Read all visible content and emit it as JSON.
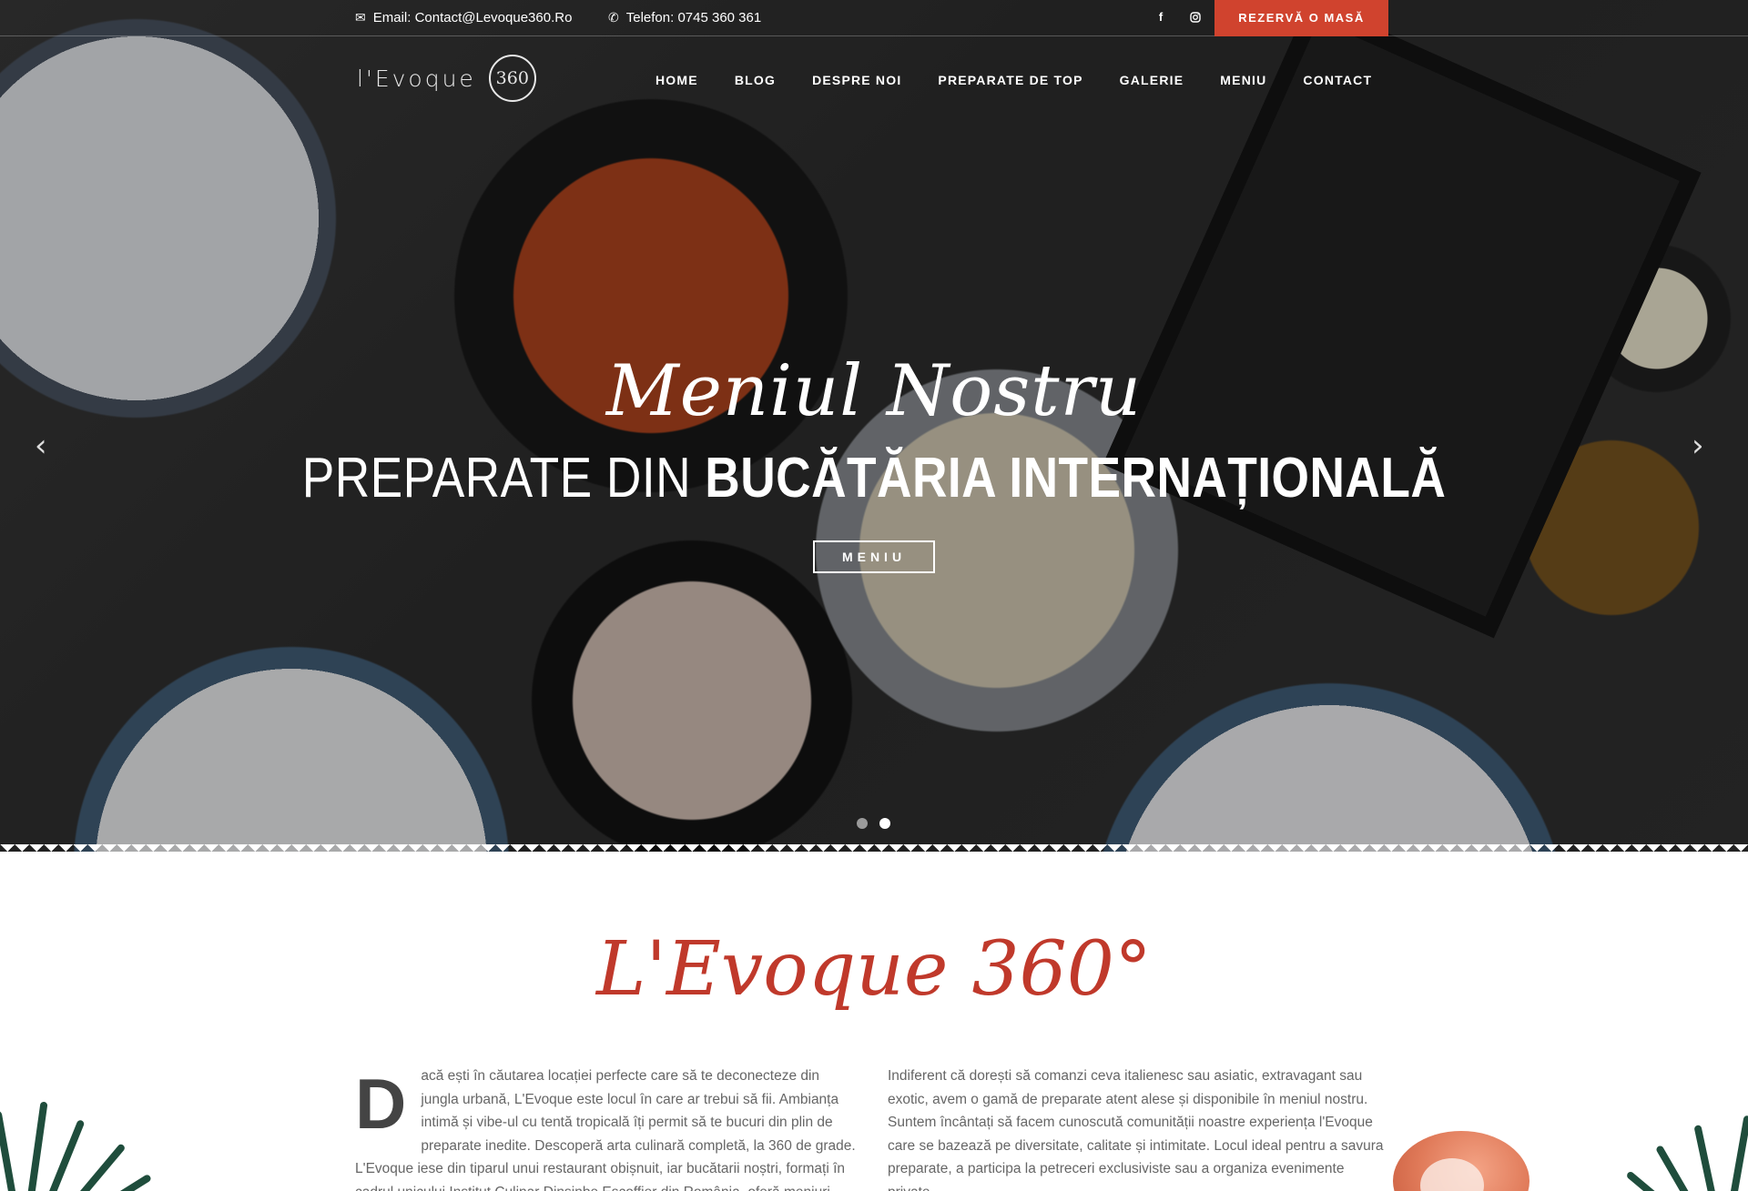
{
  "topbar": {
    "email": "Email: Contact@Levoque360.Ro",
    "phone": "Telefon: 0745 360 361",
    "reserve": "REZERVĂ O MASĂ",
    "social": [
      "facebook-icon",
      "instagram-icon"
    ]
  },
  "logo": {
    "text": "l'Evoque",
    "mark": "360"
  },
  "nav": [
    "HOME",
    "BLOG",
    "DESPRE NOI",
    "PREPARATE DE TOP",
    "GALERIE",
    "MENIU",
    "CONTACT"
  ],
  "hero": {
    "script": "Meniul Nostru",
    "title_light": "PREPARATE DIN ",
    "title_bold": "BUCĂTĂRIA INTERNAȚIONALĂ",
    "button": "MENIU",
    "slides": 2,
    "active_slide": 2
  },
  "intro": {
    "title": "L'Evoque 360°",
    "dropcap": "D",
    "left_text": "acă ești în căutarea locației perfecte care să te deconecteze din jungla urbană, L'Evoque este locul în care ar trebui să fii. Ambianța intimă și vibe-ul cu tentă tropicală îți permit să te bucuri din plin de preparate inedite. Descoperă arta culinară completă, la 360 de grade. L'Evoque iese din tiparul unui restaurant obișnuit, iar bucătarii noștri, formați în cadrul unicului Institut Culinar Dinsinbe Escoffier din România, oferă meniuri speciale",
    "right_text": "Indiferent că dorești să comanzi ceva italienesc sau asiatic, extravagant sau exotic, avem o gamă de preparate atent alese și disponibile în meniul nostru. Suntem încântați să facem cunoscută comunității noastre experiența l'Evoque care se bazează pe diversitate, calitate și intimitate. Locul ideal pentru a savura preparate, a participa la petreceri exclusiviste sau a organiza evenimente private."
  },
  "colors": {
    "accent": "#d0432e",
    "title": "#c0392b"
  }
}
